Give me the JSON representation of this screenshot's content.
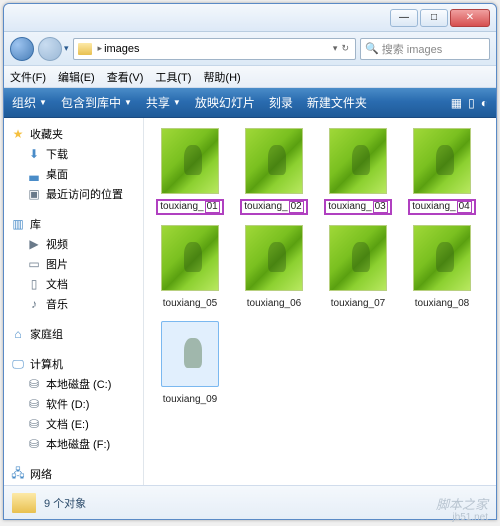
{
  "window": {
    "min": "—",
    "max": "□",
    "close": "✕"
  },
  "address": {
    "crumb": "images",
    "chev": "▸",
    "dropdown": "▾"
  },
  "search": {
    "placeholder": "搜索 images"
  },
  "menubar": {
    "file": "文件(F)",
    "edit": "编辑(E)",
    "view": "查看(V)",
    "tools": "工具(T)",
    "help": "帮助(H)"
  },
  "cmdbar": {
    "organize": "组织",
    "include": "包含到库中",
    "share": "共享",
    "slideshow": "放映幻灯片",
    "burn": "刻录",
    "newfolder": "新建文件夹"
  },
  "sidebar": {
    "favorites": {
      "label": "收藏夹"
    },
    "downloads": "下载",
    "desktop": "桌面",
    "recent": "最近访问的位置",
    "libraries": {
      "label": "库"
    },
    "videos": "视频",
    "pictures": "图片",
    "documents": "文档",
    "music": "音乐",
    "homegroup": "家庭组",
    "computer": "计算机",
    "drive_c": "本地磁盘 (C:)",
    "drive_d": "软件 (D:)",
    "drive_e": "文档 (E:)",
    "drive_f": "本地磁盘 (F:)",
    "network": "网络"
  },
  "files": [
    {
      "base": "touxiang_",
      "suffix": "01",
      "hl": true
    },
    {
      "base": "touxiang_",
      "suffix": "02",
      "hl": true
    },
    {
      "base": "touxiang_",
      "suffix": "03",
      "hl": true
    },
    {
      "base": "touxiang_",
      "suffix": "04",
      "hl": true
    },
    {
      "base": "touxiang_05",
      "suffix": "",
      "hl": false
    },
    {
      "base": "touxiang_06",
      "suffix": "",
      "hl": false
    },
    {
      "base": "touxiang_07",
      "suffix": "",
      "hl": false
    },
    {
      "base": "touxiang_08",
      "suffix": "",
      "hl": false
    },
    {
      "base": "touxiang_09",
      "suffix": "",
      "hl": false,
      "sel": true
    }
  ],
  "status": {
    "count": "9 个对象"
  },
  "watermark": {
    "brand": "脚本之家",
    "site": "jb51.net"
  }
}
